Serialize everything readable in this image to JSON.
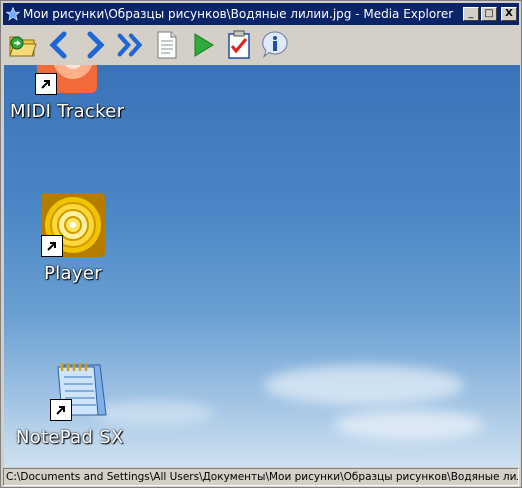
{
  "window": {
    "title": "Мои рисунки\\Образцы рисунков\\Водяные лилии.jpg - Media Explorer",
    "controls": {
      "minimize": "_",
      "maximize": "□",
      "close": "X"
    }
  },
  "toolbar": {
    "buttons": [
      {
        "icon": "folder-open-icon"
      },
      {
        "icon": "back-arrow-icon"
      },
      {
        "icon": "forward-arrow-icon"
      },
      {
        "icon": "fast-forward-icon"
      },
      {
        "icon": "document-icon"
      },
      {
        "icon": "play-icon"
      },
      {
        "icon": "checklist-icon"
      },
      {
        "icon": "info-icon"
      }
    ]
  },
  "desktop": {
    "icons": [
      {
        "label": "MIDI Tracker",
        "icon": "midi-tracker-icon"
      },
      {
        "label": "Player",
        "icon": "player-icon"
      },
      {
        "label": "NotePad SX",
        "icon": "notepad-icon"
      }
    ]
  },
  "status": {
    "path": "C:\\Documents and Settings\\All Users\\Документы\\Мои рисунки\\Образцы рисунков\\Водяные лилии.j"
  },
  "colors": {
    "titlebar": "#0a246a",
    "chrome": "#d4d0c8",
    "sky_top": "#3a73b8",
    "sky_bottom": "#cfe1f1"
  }
}
